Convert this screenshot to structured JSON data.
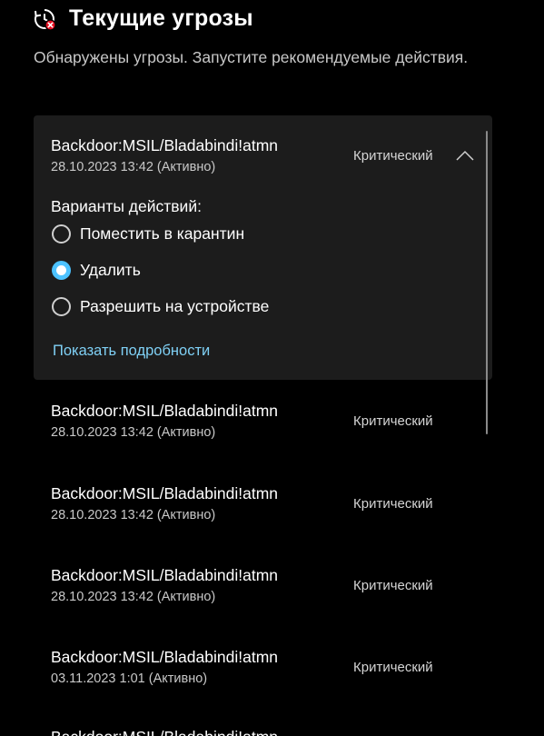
{
  "header": {
    "icon": "shield-clock-alert-icon",
    "title": "Текущие угрозы",
    "subtitle": "Обнаружены угрозы. Запустите рекомендуемые действия."
  },
  "colors": {
    "background": "#000000",
    "card": "#1c1c1c",
    "accent": "#4cc2ff",
    "link": "#7fd0f5",
    "alert": "#e81123"
  },
  "threats": [
    {
      "name": "Backdoor:MSIL/Bladabindi!atmn",
      "date": "28.10.2023 13:42 (Активно)",
      "severity": "Критический",
      "expanded": true
    },
    {
      "name": "Backdoor:MSIL/Bladabindi!atmn",
      "date": "28.10.2023 13:42 (Активно)",
      "severity": "Критический"
    },
    {
      "name": "Backdoor:MSIL/Bladabindi!atmn",
      "date": "28.10.2023 13:42 (Активно)",
      "severity": "Критический"
    },
    {
      "name": "Backdoor:MSIL/Bladabindi!atmn",
      "date": "28.10.2023 13:42 (Активно)",
      "severity": "Критический"
    },
    {
      "name": "Backdoor:MSIL/Bladabindi!atmn",
      "date": "03.11.2023 1:01 (Активно)",
      "severity": "Критический"
    },
    {
      "name": "Backdoor:MSIL/Bladabindi!atmn"
    }
  ],
  "actions": {
    "label": "Варианты действий:",
    "options": [
      {
        "label": "Поместить в карантин",
        "selected": false
      },
      {
        "label": "Удалить",
        "selected": true
      },
      {
        "label": "Разрешить на устройстве",
        "selected": false
      }
    ],
    "details_link": "Показать подробности"
  }
}
